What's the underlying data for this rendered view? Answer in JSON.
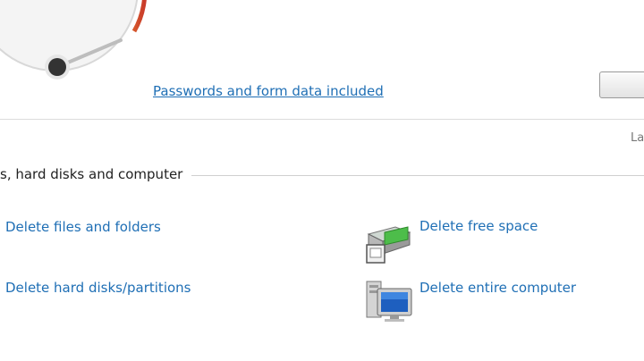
{
  "gauge": {
    "icon": "speedometer-gauge-icon"
  },
  "passwords_link": "Passwords and form data included",
  "right_fragment": "La",
  "section_title": "s, hard disks and computer",
  "actions": {
    "delete_files": "Delete files and folders",
    "delete_free_space": "Delete free space",
    "delete_disks": "Delete hard disks/partitions",
    "delete_computer": "Delete entire computer"
  },
  "icons": {
    "free_space": "free-space-drive-icon",
    "computer": "computer-icon"
  },
  "colors": {
    "link": "#1f6fb5",
    "gauge_red": "#c93a2a",
    "gauge_green": "#7fbf3a"
  }
}
